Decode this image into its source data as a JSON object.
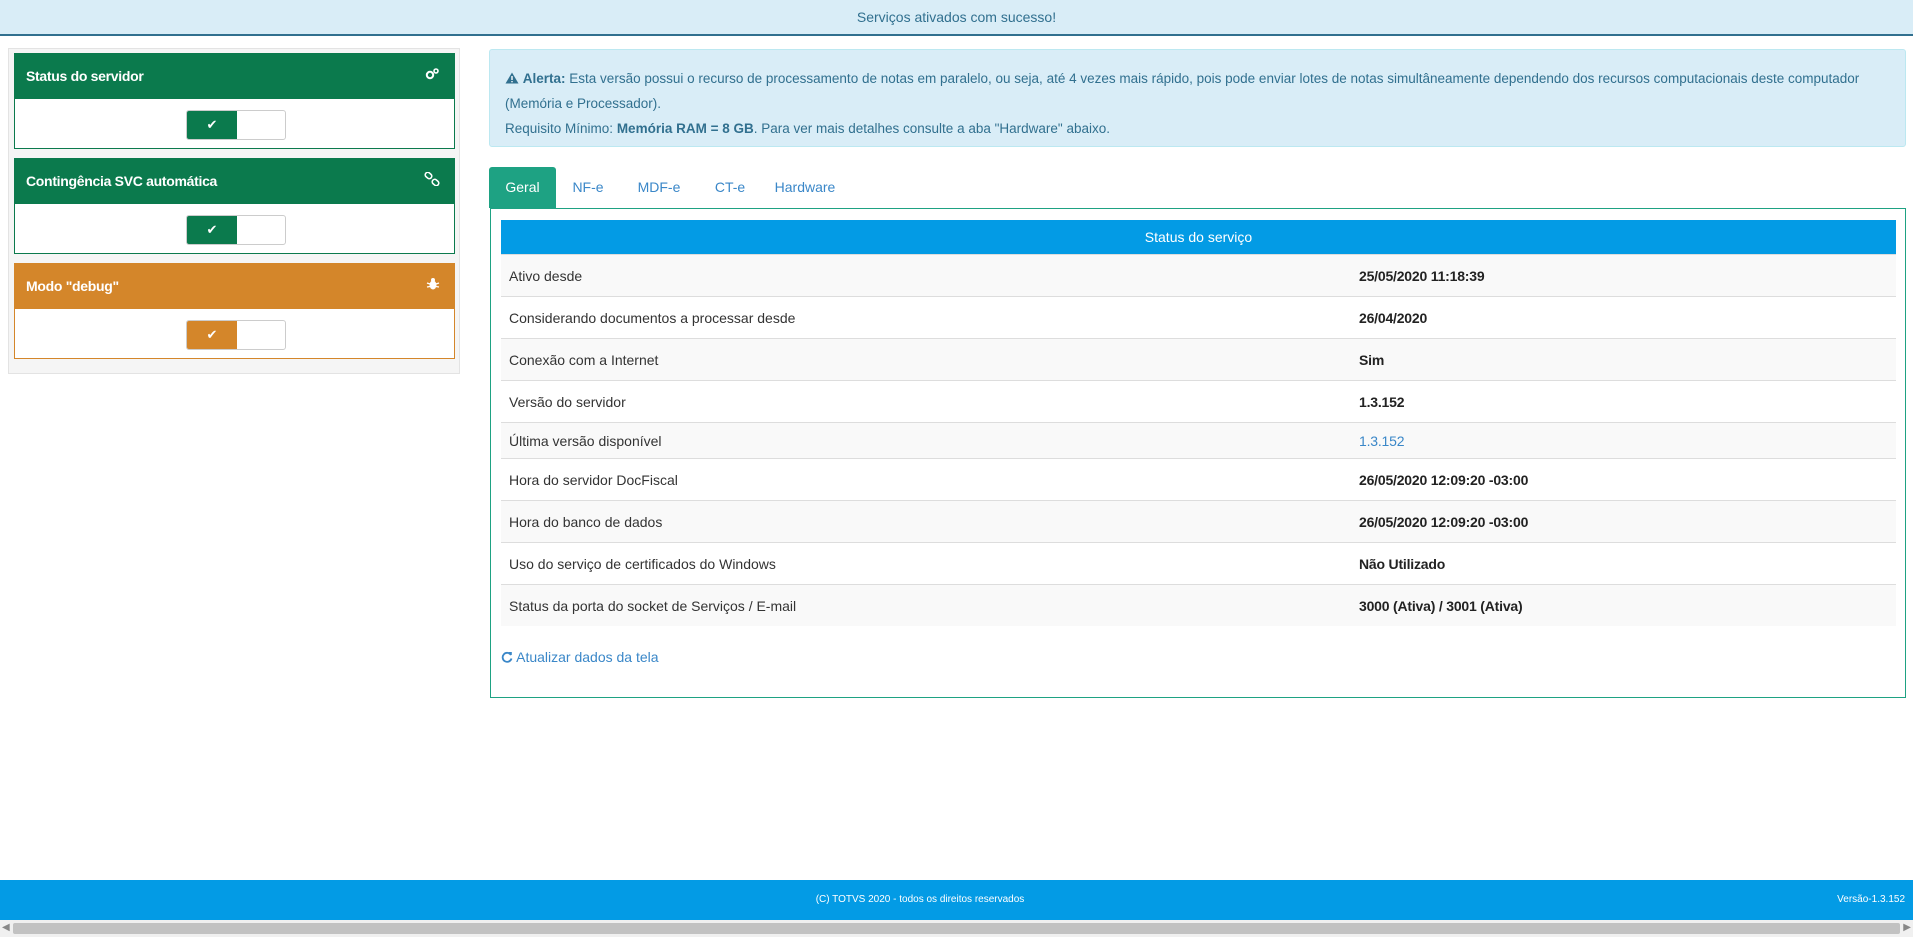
{
  "top_alert": {
    "message": "Serviços ativados com sucesso!"
  },
  "left_panels": [
    {
      "title": "Status do servidor",
      "icon": "gears-icon",
      "toggle_on": true,
      "color": "#0b7a4d"
    },
    {
      "title": "Contingência SVC automática",
      "icon": "chain-icon",
      "toggle_on": true,
      "color": "#0b7a4d"
    },
    {
      "title": "Modo \"debug\"",
      "icon": "bug-icon",
      "toggle_on": true,
      "color": "#d4862a"
    }
  ],
  "toggle_check": "✔",
  "info_alert": {
    "label": "Alerta:",
    "text": "Esta versão possui o recurso de processamento de notas em paralelo, ou seja, até 4 vezes mais rápido, pois pode enviar lotes de notas simultâneamente dependendo dos recursos computacionais deste computador (Memória e Processador).",
    "req_prefix": "Requisito Mínimo:",
    "req_value": "Memória RAM = 8 GB",
    "req_suffix": ". Para ver mais detalhes consulte a aba \"Hardware\" abaixo."
  },
  "tabs": [
    {
      "label": "Geral",
      "active": true
    },
    {
      "label": "NF-e",
      "active": false
    },
    {
      "label": "MDF-e",
      "active": false
    },
    {
      "label": "CT-e",
      "active": false
    },
    {
      "label": "Hardware",
      "active": false
    }
  ],
  "service_status": {
    "header": "Status do serviço",
    "rows": [
      {
        "label": "Ativo desde",
        "value": "25/05/2020 11:18:39"
      },
      {
        "label": "Considerando documentos a processar desde",
        "value": "26/04/2020"
      },
      {
        "label": "Conexão com a Internet",
        "value": "Sim"
      },
      {
        "label": "Versão do servidor",
        "value": "1.3.152"
      },
      {
        "label": "Última versão disponível",
        "value": "1.3.152",
        "is_link": true
      },
      {
        "label": "Hora do servidor DocFiscal",
        "value": "26/05/2020 12:09:20 -03:00"
      },
      {
        "label": "Hora do banco de dados",
        "value": "26/05/2020 12:09:20 -03:00"
      },
      {
        "label": "Uso do serviço de certificados do Windows",
        "value": "Não Utilizado"
      },
      {
        "label": "Status da porta do socket de Serviços / E-mail",
        "value": "3000 (Ativa) / 3001 (Ativa)"
      }
    ],
    "refresh_label": "Atualizar dados da tela"
  },
  "footer": {
    "copyright": "(C) TOTVS 2020 - todos os direitos reservados",
    "version": "Versão-1.3.152"
  },
  "colors": {
    "success_green": "#0b7a4d",
    "warning_orange": "#d4862a",
    "primary_blue": "#039be5",
    "tab_active": "#1ea283",
    "info_bg": "#d9edf7"
  }
}
